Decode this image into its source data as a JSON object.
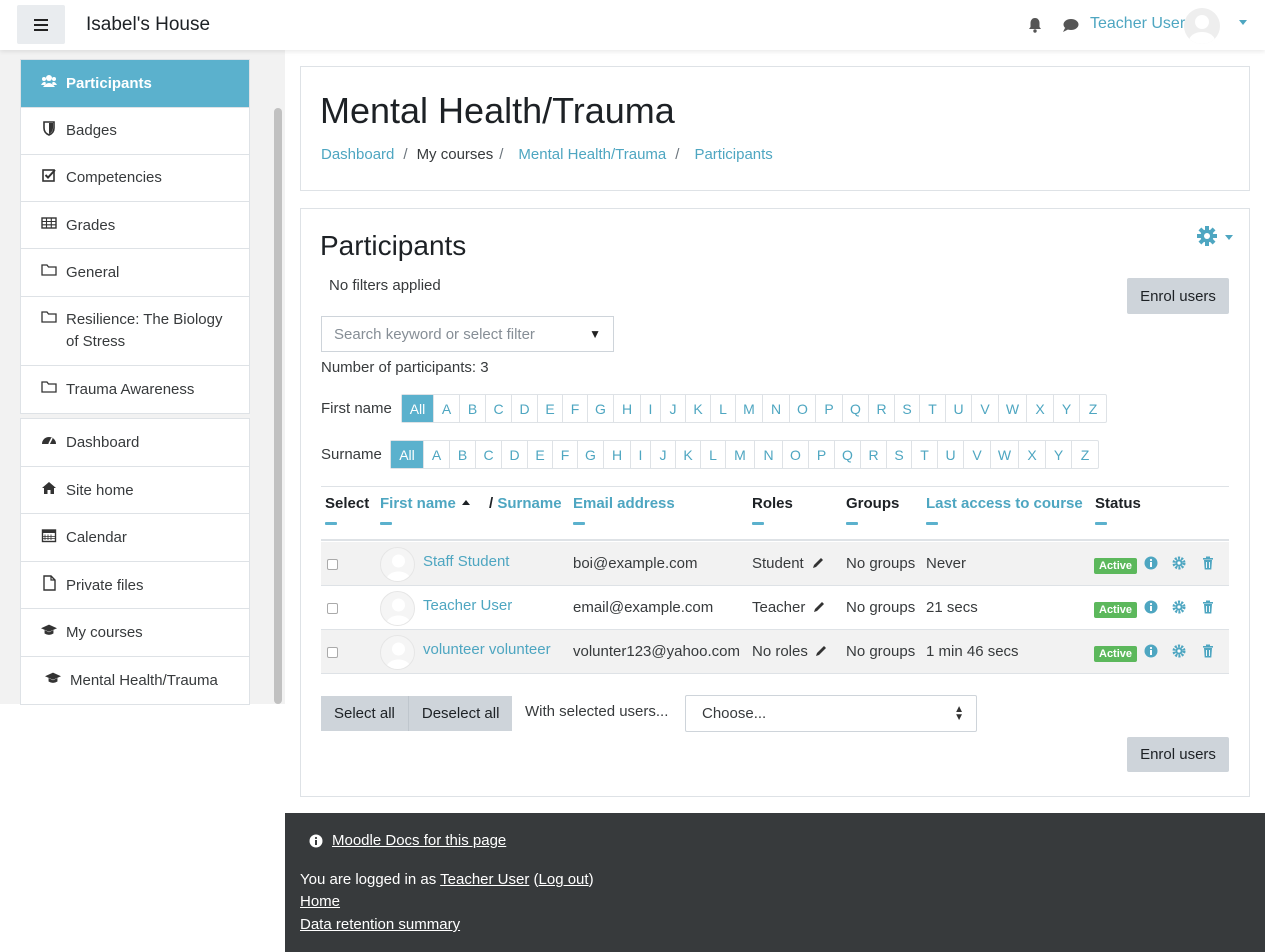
{
  "navbar": {
    "site_name": "Isabel's House",
    "user_name": "Teacher User"
  },
  "sidebar": {
    "course_items": [
      {
        "label": "Participants",
        "icon": "users-icon",
        "active": true
      },
      {
        "label": "Badges",
        "icon": "shield-icon"
      },
      {
        "label": "Competencies",
        "icon": "checkbox-icon"
      },
      {
        "label": "Grades",
        "icon": "table-icon"
      },
      {
        "label": "General",
        "icon": "folder-icon"
      },
      {
        "label": "Resilience: The Biology of Stress",
        "icon": "folder-icon"
      },
      {
        "label": "Trauma Awareness",
        "icon": "folder-icon"
      }
    ],
    "site_items": [
      {
        "label": "Dashboard",
        "icon": "dashboard-icon"
      },
      {
        "label": "Site home",
        "icon": "home-icon"
      },
      {
        "label": "Calendar",
        "icon": "calendar-icon"
      },
      {
        "label": "Private files",
        "icon": "file-icon"
      },
      {
        "label": "My courses",
        "icon": "graduation-cap-icon"
      },
      {
        "label": "Mental Health/Trauma",
        "icon": "graduation-cap-icon"
      }
    ]
  },
  "header": {
    "title": "Mental Health/Trauma",
    "breadcrumb": [
      "Dashboard",
      "My courses",
      "Mental Health/Trauma",
      "Participants"
    ]
  },
  "participants": {
    "title": "Participants",
    "no_filters": "No filters applied",
    "enrol_label": "Enrol users",
    "search_placeholder": "Search keyword or select filter",
    "count_text": "Number of participants: 3",
    "firstname_label": "First name",
    "surname_label": "Surname",
    "all_label": "All",
    "letters": [
      "A",
      "B",
      "C",
      "D",
      "E",
      "F",
      "G",
      "H",
      "I",
      "J",
      "K",
      "L",
      "M",
      "N",
      "O",
      "P",
      "Q",
      "R",
      "S",
      "T",
      "U",
      "V",
      "W",
      "X",
      "Y",
      "Z"
    ],
    "columns": {
      "select": "Select",
      "first_name": "First name",
      "surname": "Surname",
      "email": "Email address",
      "roles": "Roles",
      "groups": "Groups",
      "last_access": "Last access to course",
      "status": "Status"
    },
    "rows": [
      {
        "name": "Staff Student",
        "email": "boi@example.com",
        "role": "Student",
        "groups": "No groups",
        "last_access": "Never",
        "status": "Active"
      },
      {
        "name": "Teacher User",
        "email": "email@example.com",
        "role": "Teacher",
        "groups": "No groups",
        "last_access": "21 secs",
        "status": "Active"
      },
      {
        "name": "volunteer volunteer",
        "email": "volunter123@yahoo.com",
        "role": "No roles",
        "groups": "No groups",
        "last_access": "1 min 46 secs",
        "status": "Active"
      }
    ],
    "select_all": "Select all",
    "deselect_all": "Deselect all",
    "with_selected": "With selected users...",
    "choose": "Choose..."
  },
  "footer": {
    "docs_link": "Moodle Docs for this page",
    "logged_in_prefix": "You are logged in as",
    "logged_in_user": "Teacher User",
    "logout": "Log out",
    "home": "Home",
    "data_retention": "Data retention summary"
  },
  "colors": {
    "accent": "#5bb1cd",
    "link": "#4ea6c1",
    "active_badge": "#5cb85c",
    "footer_bg": "#373a3c"
  }
}
